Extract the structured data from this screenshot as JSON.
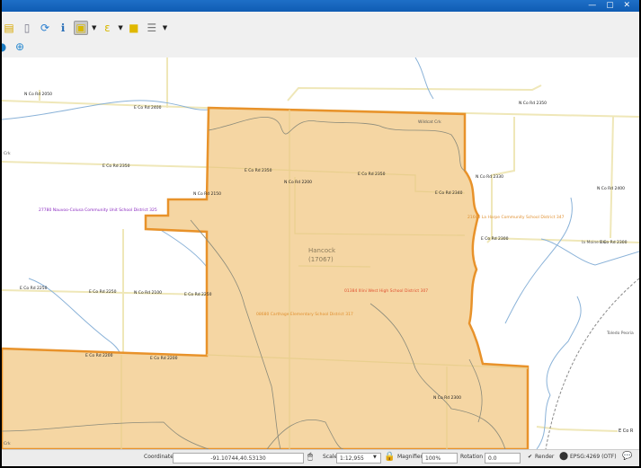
{
  "window": {
    "controls": "— ▢ ✕"
  },
  "toolbar": {
    "icons": [
      "layer-icon",
      "save-icon",
      "refresh-icon",
      "identify-icon",
      "select-feature-icon",
      "select-expression-icon",
      "deselect-icon",
      "attribute-table-icon"
    ],
    "row2_icons": [
      "globe-icon",
      "add-layer-icon"
    ]
  },
  "map": {
    "fill_color": "#f5d6a3",
    "boundary_color": "#e8922a",
    "county_label": "Hancock",
    "county_code": "(17067)",
    "district_labels": {
      "nauvoo": "27780 Nauvoo-Colusa Community Unit School District 325",
      "la_harpe": "21660 La Harpe Community School District 347",
      "illini": "01384 Illini West High School District 307",
      "carthage": "08680 Carthage Elementary School District 317"
    },
    "road_labels": [
      "N Co Rd 2050",
      "E Co Rd 2400",
      "E Co Rd 2350",
      "E Co Rd 2350",
      "E Co Rd 2350",
      "N Co Rd 2200",
      "N Co Rd 2150",
      "E Co Rd 2340",
      "N Co Rd 2350",
      "N Co Rd 2330",
      "N Co Rd 2400",
      "E Co Rd 2300",
      "E Co Rd 2250",
      "E Co Rd 2250",
      "N Co Rd 2100",
      "E Co Rd 2250",
      "E Co Rd 2200",
      "E Co Rd 2200",
      "N Co Rd 2300",
      "E Co R",
      "E Co Rd 2300"
    ],
    "water_labels": [
      "Wildcat Crk",
      "Crk",
      "Crk",
      "la Moine Riv"
    ],
    "rail_label": "Toledo Peoria"
  },
  "status": {
    "coordinate_label": "Coordinate",
    "coordinate_value": "-91.10744,40.53130",
    "scale_label": "Scale",
    "scale_value": "1:12,955",
    "magnifier_label": "Magnifier",
    "magnifier_value": "100%",
    "rotation_label": "Rotation",
    "rotation_value": "0.0",
    "render_label": "Render",
    "render_checked": true,
    "crs": "EPSG:4269 (OTF)"
  }
}
